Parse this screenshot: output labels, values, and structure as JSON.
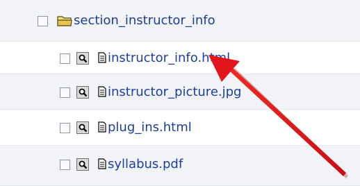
{
  "folder": {
    "name": "section_instructor_info",
    "icon": "folder-icon"
  },
  "files": [
    {
      "name": "instructor_info.html",
      "icon": "document-icon",
      "preview_icon": "magnifier-icon"
    },
    {
      "name": "instructor_picture.jpg",
      "icon": "document-icon",
      "preview_icon": "magnifier-icon"
    },
    {
      "name": "plug_ins.html",
      "icon": "document-icon",
      "preview_icon": "magnifier-icon"
    },
    {
      "name": "syllabus.pdf",
      "icon": "document-icon",
      "preview_icon": "magnifier-icon"
    }
  ],
  "colors": {
    "link": "#1c3e9c",
    "row_shade": "#f1f3f6",
    "arrow": "#e3141b"
  }
}
